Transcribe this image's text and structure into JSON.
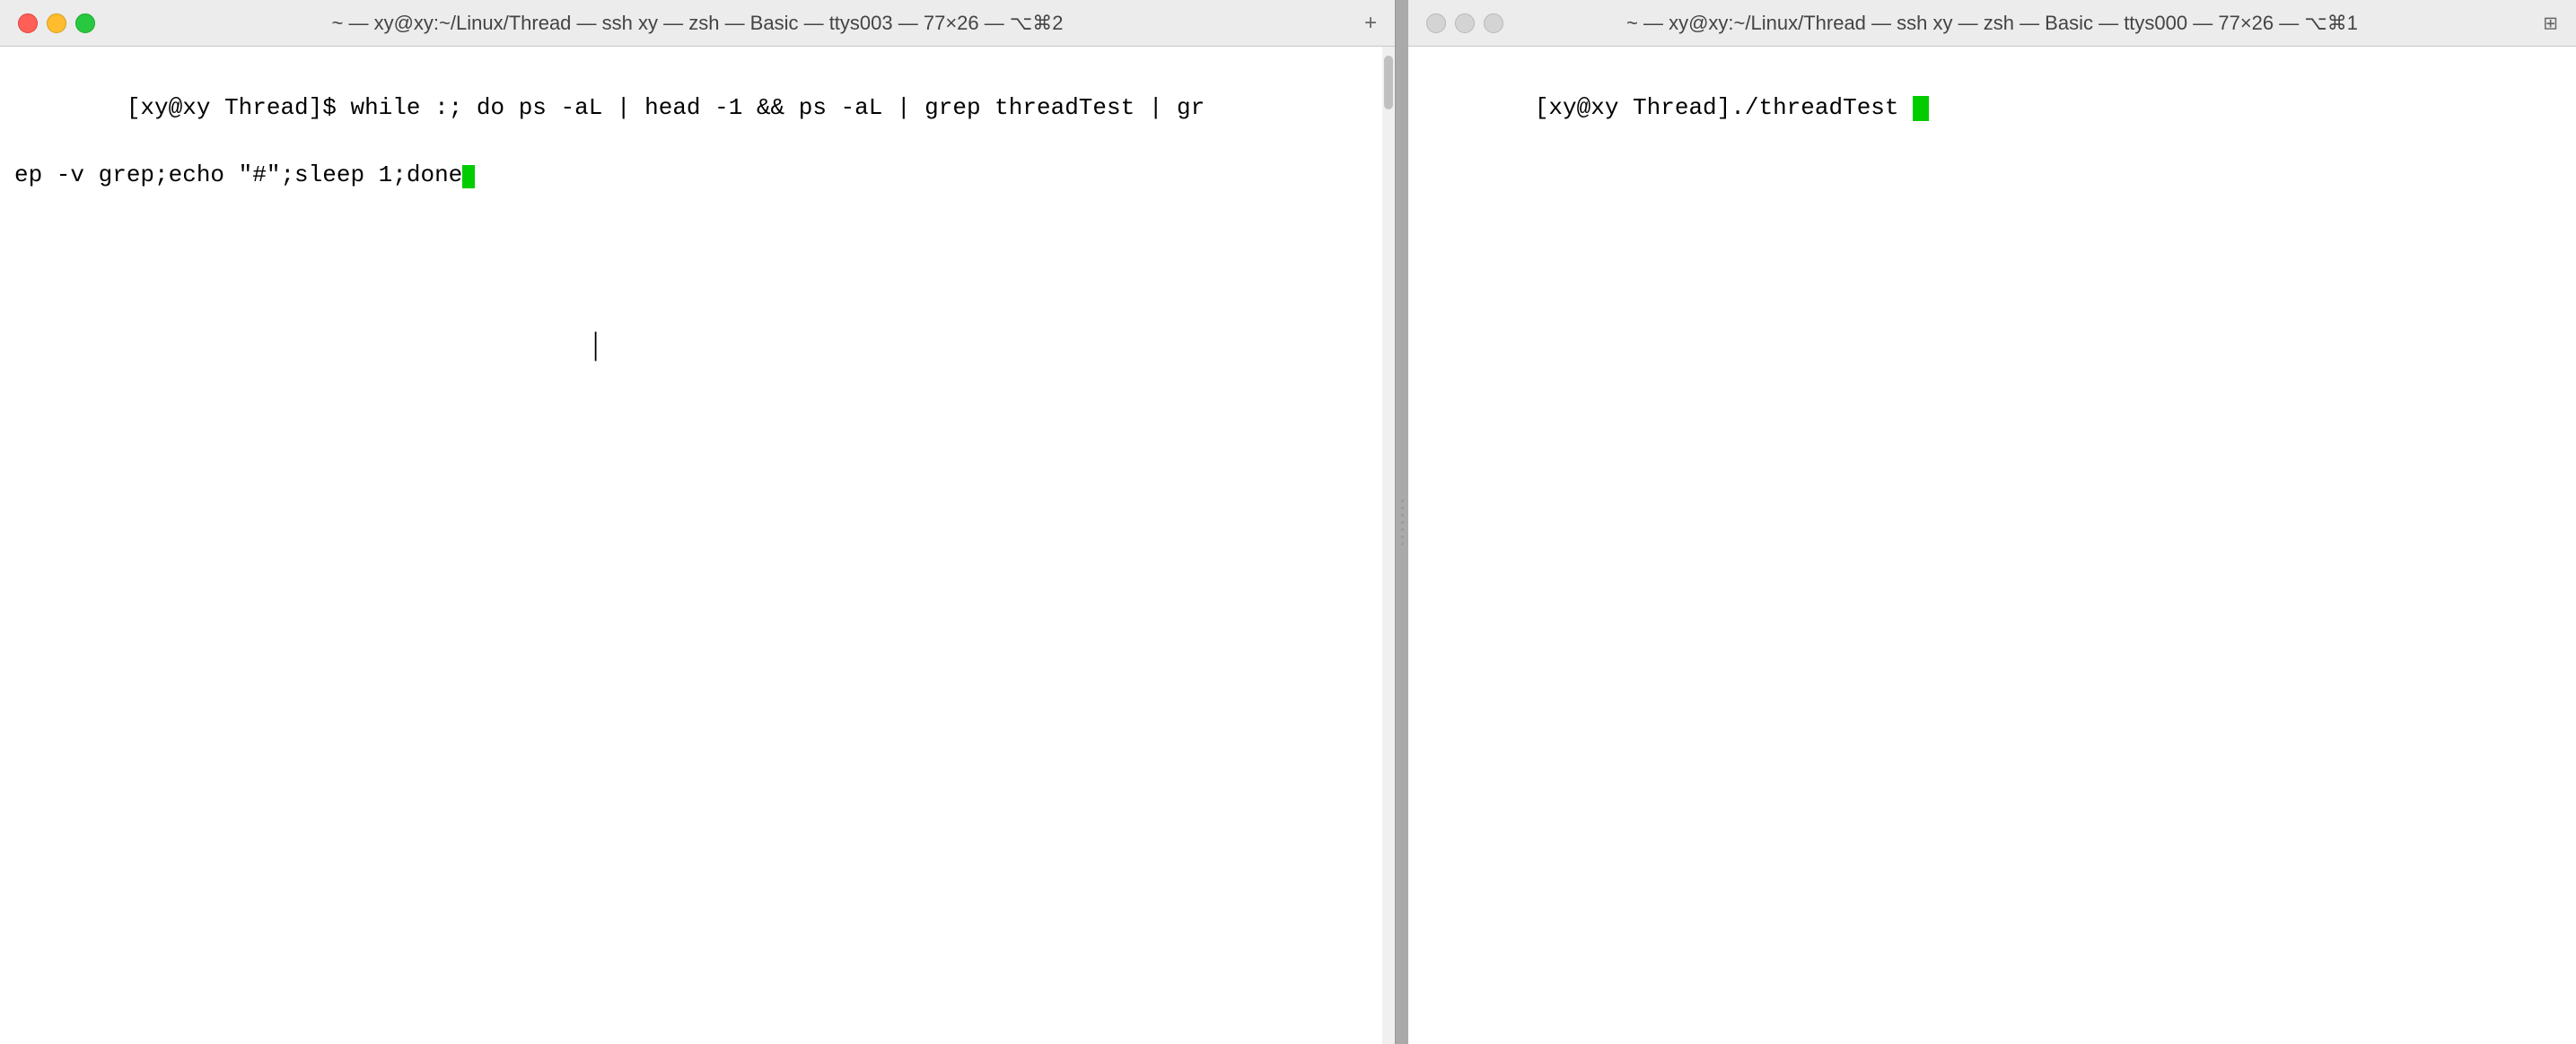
{
  "window_left": {
    "titlebar": {
      "title": "~ — xy@xy:~/Linux/Thread — ssh xy — zsh — Basic — ttys003 — 77×26 — ⌥⌘2",
      "add_tab_label": "+",
      "traffic_lights": [
        "close",
        "minimize",
        "maximize"
      ]
    },
    "terminal": {
      "prompt": "[xy@xy Thread]$ ",
      "command_line1": "while :; do ps -aL | head -1 && ps -aL | grep threadTest | gr",
      "command_line2": "ep -v grep;echo \"#\";sleep 1;done"
    }
  },
  "window_right": {
    "titlebar": {
      "title": "~ — xy@xy:~/Linux/Thread — ssh xy — zsh — Basic — ttys000 — 77×26 — ⌥⌘1",
      "traffic_lights": [
        "close_inactive",
        "minimize_inactive",
        "maximize_inactive"
      ]
    },
    "terminal": {
      "prompt": "[xy@xy Thread]",
      "command": "./threadTest "
    }
  }
}
